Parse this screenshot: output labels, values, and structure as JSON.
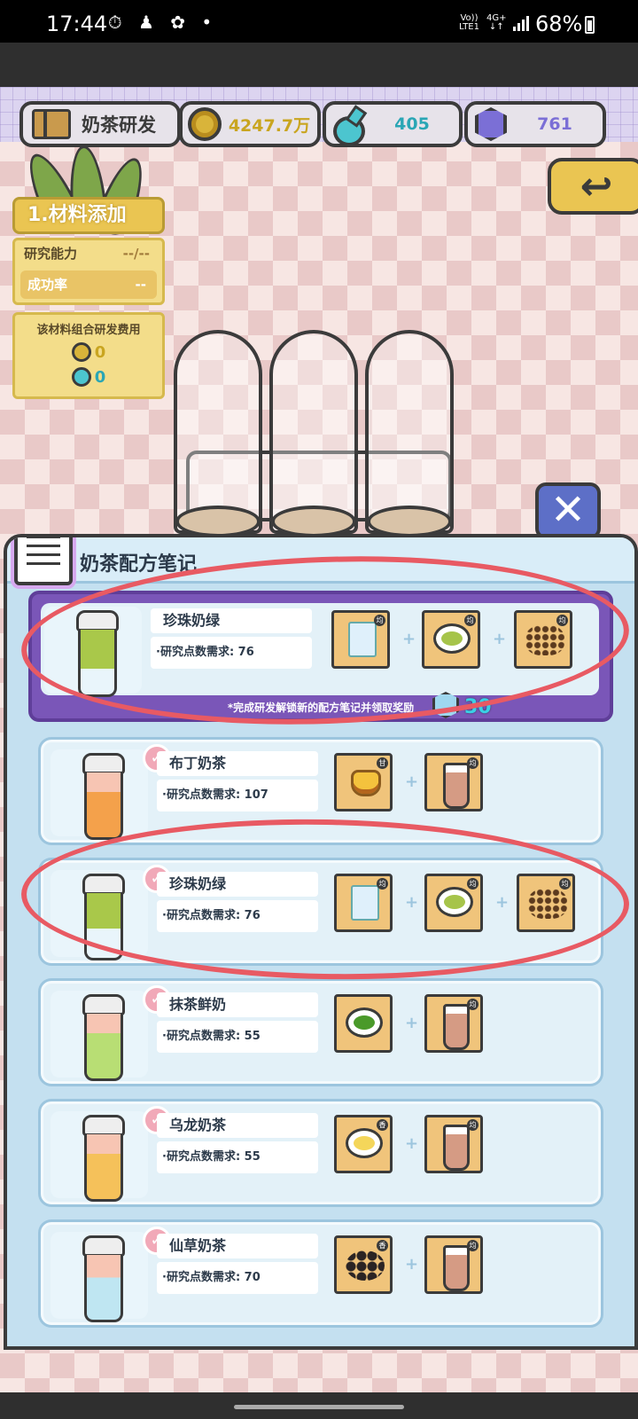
{
  "status_bar": {
    "time": "17:44",
    "icons": "⏱ ♟ ✿ •",
    "network_top": "Vo))",
    "network_bottom": "LTE1",
    "gen_top": "4G+",
    "gen_bottom": "↓↑",
    "battery": "68%"
  },
  "hud": {
    "title": "奶茶研发",
    "gold": "4247.7万",
    "potion": "405",
    "gem": "761",
    "back_label": "↩"
  },
  "left_panel": {
    "step": "1.材料添加",
    "ability_label": "研究能力",
    "ability_value": "--/--",
    "success_label": "成功率",
    "success_value": "--",
    "cost_title": "该材料组合研发费用",
    "cost_gold": "0",
    "cost_potion": "0"
  },
  "recipe_book": {
    "title": "奶茶配方笔记",
    "close_label": "✕",
    "reward_text": "*完成研发解锁新的配方笔记并领取奖励",
    "reward_amount": "30",
    "check": "✓",
    "plus": "+",
    "tag_j": "均",
    "tag_t": "甘",
    "tag_x": "香",
    "items": [
      {
        "name": "珍珠奶绿",
        "req": "·研究点数需求: 76",
        "color": "#a9c84a"
      },
      {
        "name": "布丁奶茶",
        "req": "·研究点数需求: 107",
        "color": "#f4a14b"
      },
      {
        "name": "珍珠奶绿",
        "req": "·研究点数需求: 76",
        "color": "#a9c84a"
      },
      {
        "name": "抹茶鲜奶",
        "req": "·研究点数需求: 55",
        "color": "#b8de74"
      },
      {
        "name": "乌龙奶茶",
        "req": "·研究点数需求: 55",
        "color": "#f5c15a"
      },
      {
        "name": "仙草奶茶",
        "req": "·研究点数需求: 70",
        "color": "#bfe6f2"
      }
    ]
  }
}
